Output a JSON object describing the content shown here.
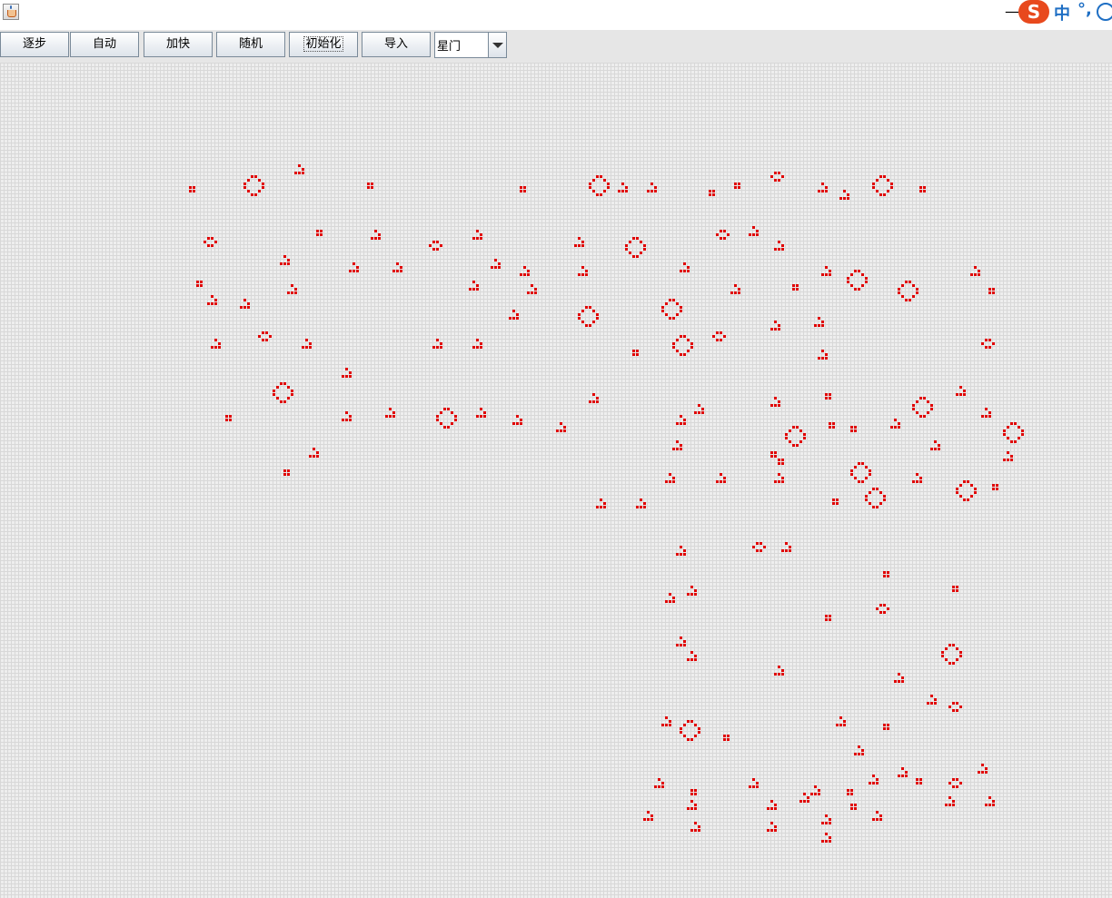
{
  "window": {
    "minimize_symbol": "—"
  },
  "ime": {
    "logo": "S",
    "mode": "中",
    "punct": "°,"
  },
  "toolbar": {
    "buttons": [
      {
        "id": "step",
        "label": "逐步"
      },
      {
        "id": "auto",
        "label": "自动"
      },
      {
        "id": "faster",
        "label": "加快"
      },
      {
        "id": "random",
        "label": "随机"
      },
      {
        "id": "init",
        "label": "初始化"
      },
      {
        "id": "import",
        "label": "导入"
      }
    ],
    "pattern_select": {
      "selected": "星门"
    }
  },
  "board": {
    "live_color": "#e00000",
    "grid_color": "#d8d8d8",
    "background": "#eeeeee",
    "clusters": [
      [
        52,
        34,
        "2x2"
      ],
      [
        67,
        31,
        "ring"
      ],
      [
        81,
        28,
        "glider"
      ],
      [
        101,
        33,
        "2x2"
      ],
      [
        143,
        34,
        "2x2"
      ],
      [
        162,
        31,
        "ring"
      ],
      [
        170,
        33,
        "glider"
      ],
      [
        178,
        33,
        "glider"
      ],
      [
        195,
        35,
        "2x2"
      ],
      [
        202,
        33,
        "2x2"
      ],
      [
        212,
        30,
        "bee"
      ],
      [
        225,
        33,
        "glider"
      ],
      [
        231,
        35,
        "glider"
      ],
      [
        240,
        31,
        "ring"
      ],
      [
        253,
        34,
        "2x2"
      ],
      [
        87,
        46,
        "2x2"
      ],
      [
        102,
        46,
        "glider"
      ],
      [
        130,
        46,
        "glider"
      ],
      [
        56,
        48,
        "bee"
      ],
      [
        118,
        49,
        "bee"
      ],
      [
        158,
        48,
        "glider"
      ],
      [
        172,
        48,
        "ring"
      ],
      [
        197,
        46,
        "bee"
      ],
      [
        206,
        45,
        "glider"
      ],
      [
        213,
        49,
        "glider"
      ],
      [
        77,
        53,
        "glider"
      ],
      [
        96,
        55,
        "glider"
      ],
      [
        108,
        55,
        "glider"
      ],
      [
        135,
        54,
        "glider"
      ],
      [
        143,
        56,
        "glider"
      ],
      [
        159,
        56,
        "glider"
      ],
      [
        187,
        55,
        "glider"
      ],
      [
        226,
        56,
        "glider"
      ],
      [
        267,
        56,
        "glider"
      ],
      [
        54,
        60,
        "2x2"
      ],
      [
        57,
        64,
        "glider"
      ],
      [
        66,
        65,
        "glider"
      ],
      [
        79,
        61,
        "glider"
      ],
      [
        129,
        60,
        "glider"
      ],
      [
        145,
        61,
        "glider"
      ],
      [
        159,
        67,
        "ring"
      ],
      [
        182,
        65,
        "ring"
      ],
      [
        201,
        61,
        "glider"
      ],
      [
        218,
        61,
        "2x2"
      ],
      [
        233,
        57,
        "ring"
      ],
      [
        247,
        60,
        "ring"
      ],
      [
        272,
        62,
        "2x2"
      ],
      [
        58,
        76,
        "glider"
      ],
      [
        71,
        74,
        "bee"
      ],
      [
        83,
        76,
        "glider"
      ],
      [
        94,
        84,
        "glider"
      ],
      [
        119,
        76,
        "glider"
      ],
      [
        130,
        76,
        "glider"
      ],
      [
        140,
        68,
        "glider"
      ],
      [
        174,
        79,
        "2x2"
      ],
      [
        185,
        75,
        "ring"
      ],
      [
        196,
        74,
        "bee"
      ],
      [
        212,
        71,
        "glider"
      ],
      [
        224,
        70,
        "glider"
      ],
      [
        225,
        79,
        "glider"
      ],
      [
        270,
        76,
        "bee"
      ],
      [
        75,
        88,
        "ring"
      ],
      [
        62,
        97,
        "2x2"
      ],
      [
        94,
        96,
        "glider"
      ],
      [
        106,
        95,
        "glider"
      ],
      [
        120,
        95,
        "ring"
      ],
      [
        131,
        95,
        "glider"
      ],
      [
        141,
        97,
        "glider"
      ],
      [
        153,
        99,
        "glider"
      ],
      [
        162,
        91,
        "glider"
      ],
      [
        186,
        97,
        "glider"
      ],
      [
        185,
        104,
        "glider"
      ],
      [
        191,
        94,
        "glider"
      ],
      [
        212,
        92,
        "glider"
      ],
      [
        216,
        100,
        "ring"
      ],
      [
        214,
        109,
        "2x2"
      ],
      [
        227,
        91,
        "2x2"
      ],
      [
        228,
        99,
        "2x2"
      ],
      [
        234,
        100,
        "2x2"
      ],
      [
        245,
        98,
        "glider"
      ],
      [
        251,
        92,
        "ring"
      ],
      [
        263,
        89,
        "glider"
      ],
      [
        270,
        95,
        "glider"
      ],
      [
        276,
        99,
        "ring"
      ],
      [
        78,
        112,
        "2x2"
      ],
      [
        85,
        106,
        "glider"
      ],
      [
        183,
        113,
        "glider"
      ],
      [
        197,
        113,
        "glider"
      ],
      [
        212,
        107,
        "2x2"
      ],
      [
        213,
        113,
        "glider"
      ],
      [
        234,
        110,
        "ring"
      ],
      [
        256,
        104,
        "glider"
      ],
      [
        251,
        113,
        "glider"
      ],
      [
        276,
        107,
        "glider"
      ],
      [
        164,
        120,
        "glider"
      ],
      [
        175,
        120,
        "glider"
      ],
      [
        229,
        120,
        "2x2"
      ],
      [
        238,
        117,
        "ring"
      ],
      [
        263,
        115,
        "ring"
      ],
      [
        273,
        116,
        "2x2"
      ],
      [
        186,
        133,
        "glider"
      ],
      [
        207,
        132,
        "bee"
      ],
      [
        215,
        132,
        "glider"
      ],
      [
        243,
        140,
        "2x2"
      ],
      [
        262,
        144,
        "2x2"
      ],
      [
        183,
        146,
        "glider"
      ],
      [
        189,
        144,
        "glider"
      ],
      [
        227,
        152,
        "2x2"
      ],
      [
        241,
        149,
        "bee"
      ],
      [
        259,
        160,
        "ring"
      ],
      [
        186,
        158,
        "glider"
      ],
      [
        189,
        162,
        "glider"
      ],
      [
        213,
        166,
        "glider"
      ],
      [
        246,
        168,
        "glider"
      ],
      [
        255,
        174,
        "glider"
      ],
      [
        261,
        176,
        "bee"
      ],
      [
        182,
        180,
        "glider"
      ],
      [
        187,
        181,
        "ring"
      ],
      [
        199,
        185,
        "2x2"
      ],
      [
        230,
        180,
        "glider"
      ],
      [
        235,
        188,
        "glider"
      ],
      [
        243,
        182,
        "2x2"
      ],
      [
        269,
        193,
        "glider"
      ],
      [
        180,
        197,
        "glider"
      ],
      [
        190,
        200,
        "2x2"
      ],
      [
        206,
        197,
        "glider"
      ],
      [
        223,
        199,
        "glider"
      ],
      [
        233,
        200,
        "2x2"
      ],
      [
        239,
        196,
        "glider"
      ],
      [
        247,
        194,
        "glider"
      ],
      [
        252,
        197,
        "2x2"
      ],
      [
        261,
        197,
        "bee"
      ],
      [
        271,
        202,
        "glider"
      ],
      [
        177,
        206,
        "glider"
      ],
      [
        189,
        203,
        "glider"
      ],
      [
        190,
        209,
        "glider"
      ],
      [
        211,
        203,
        "glider"
      ],
      [
        211,
        209,
        "glider"
      ],
      [
        220,
        201,
        "glider"
      ],
      [
        226,
        207,
        "glider"
      ],
      [
        226,
        212,
        "glider"
      ],
      [
        234,
        204,
        "2x2"
      ],
      [
        240,
        206,
        "glider"
      ],
      [
        260,
        202,
        "glider"
      ]
    ]
  }
}
